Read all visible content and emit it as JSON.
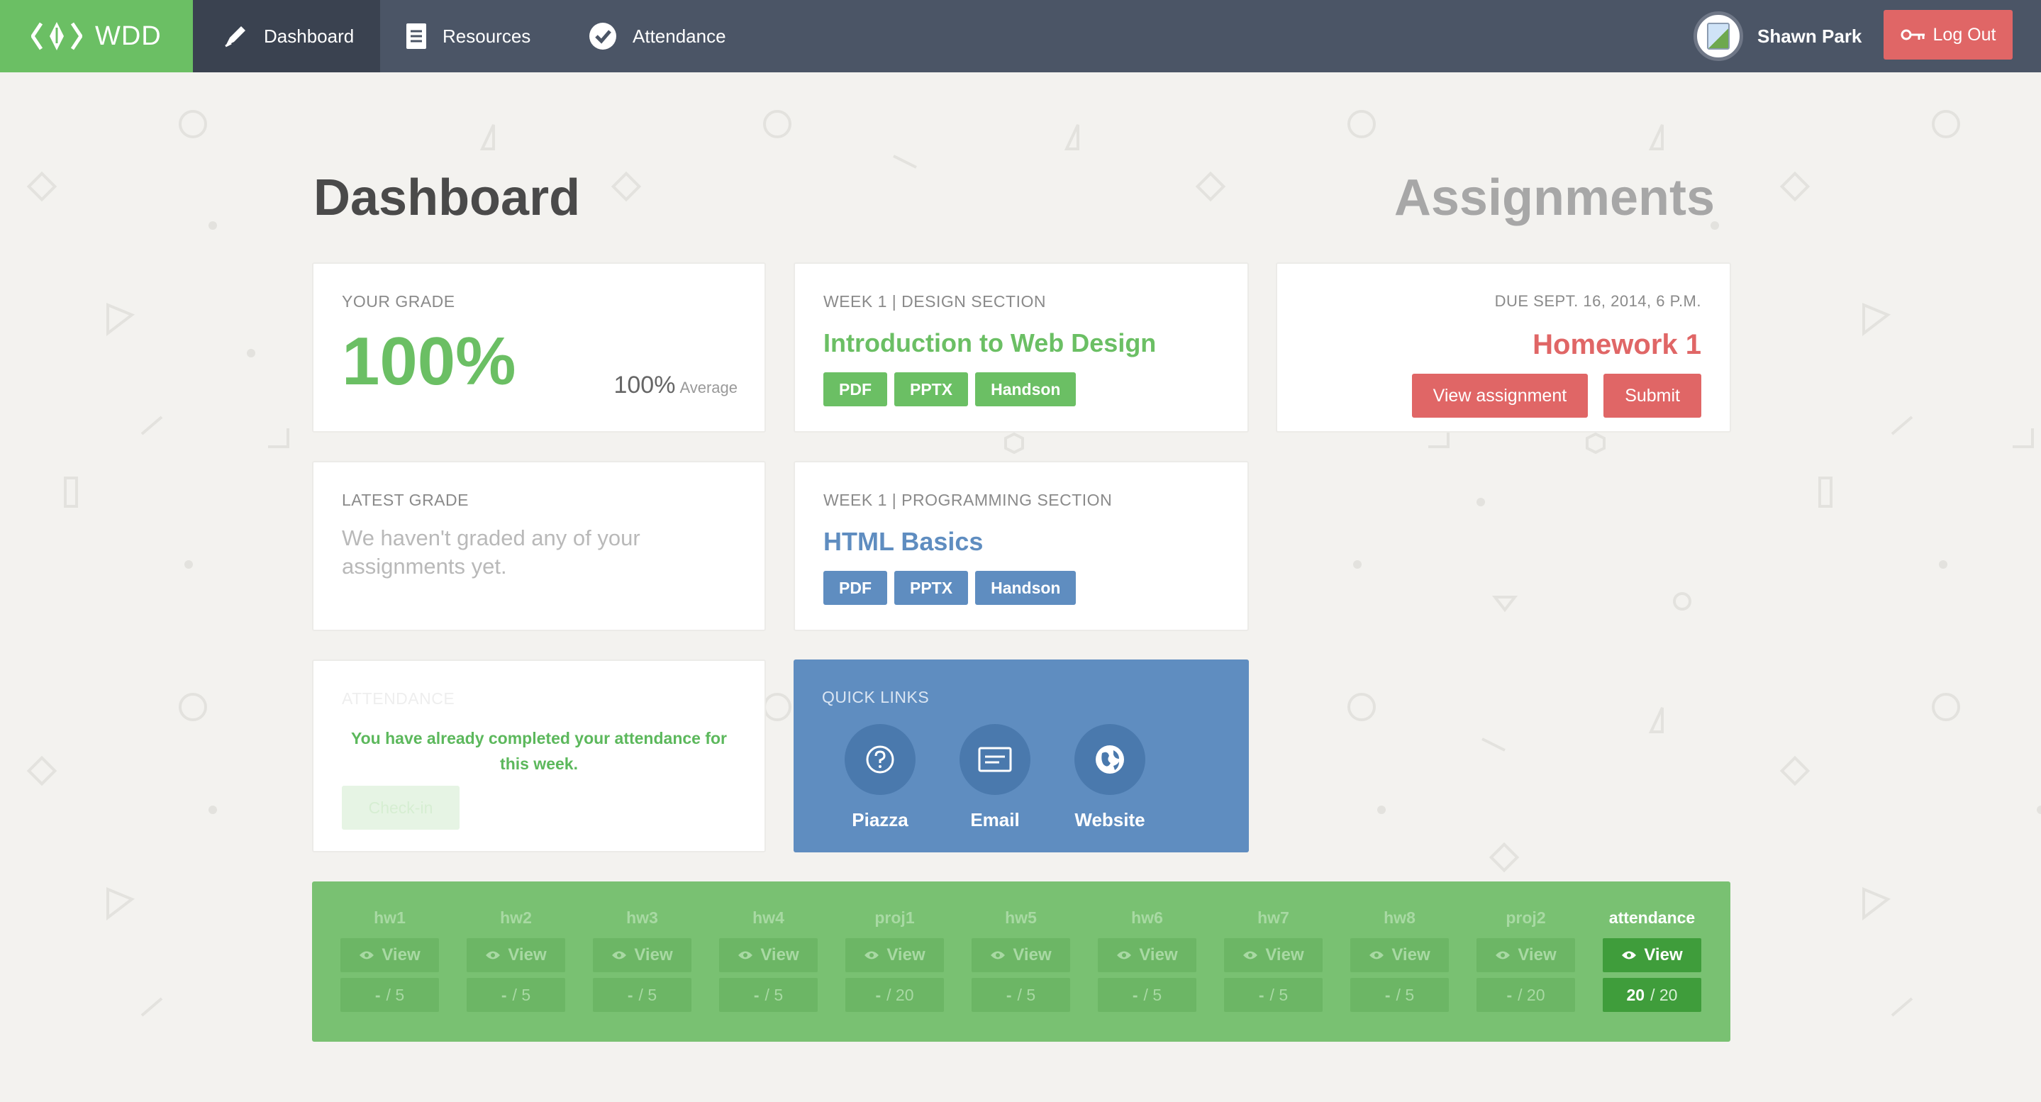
{
  "brand": {
    "name": "WDD"
  },
  "nav": {
    "items": [
      {
        "label": "Dashboard"
      },
      {
        "label": "Resources"
      },
      {
        "label": "Attendance"
      }
    ]
  },
  "user": {
    "name": "Shawn Park",
    "logout_label": "Log Out"
  },
  "headings": {
    "dashboard": "Dashboard",
    "assignments": "Assignments"
  },
  "your_grade": {
    "label": "YOUR GRADE",
    "value": "100%",
    "average_value": "100%",
    "average_label": "Average"
  },
  "latest_grade": {
    "label": "LATEST GRADE",
    "message": "We haven't graded any of your assignments yet."
  },
  "attendance": {
    "label": "ATTENDANCE",
    "message": "You have already completed your attendance for this week.",
    "checkin_label": "Check-in"
  },
  "week_design": {
    "label": "WEEK 1 | DESIGN SECTION",
    "title": "Introduction to Web Design",
    "tags": [
      "PDF",
      "PPTX",
      "Handson"
    ]
  },
  "week_programming": {
    "label": "WEEK 1 | PROGRAMMING SECTION",
    "title": "HTML Basics",
    "tags": [
      "PDF",
      "PPTX",
      "Handson"
    ]
  },
  "quick_links": {
    "label": "QUICK LINKS",
    "items": [
      {
        "label": "Piazza",
        "icon": "help-icon"
      },
      {
        "label": "Email",
        "icon": "email-icon"
      },
      {
        "label": "Website",
        "icon": "globe-icon"
      }
    ]
  },
  "homework": {
    "due": "DUE SEPT. 16, 2014, 6 P.M.",
    "title": "Homework 1",
    "view_label": "View assignment",
    "submit_label": "Submit"
  },
  "grades": [
    {
      "name": "hw1",
      "view": "View",
      "score": "-",
      "total": "5"
    },
    {
      "name": "hw2",
      "view": "View",
      "score": "-",
      "total": "5"
    },
    {
      "name": "hw3",
      "view": "View",
      "score": "-",
      "total": "5"
    },
    {
      "name": "hw4",
      "view": "View",
      "score": "-",
      "total": "5"
    },
    {
      "name": "proj1",
      "view": "View",
      "score": "-",
      "total": "20"
    },
    {
      "name": "hw5",
      "view": "View",
      "score": "-",
      "total": "5"
    },
    {
      "name": "hw6",
      "view": "View",
      "score": "-",
      "total": "5"
    },
    {
      "name": "hw7",
      "view": "View",
      "score": "-",
      "total": "5"
    },
    {
      "name": "hw8",
      "view": "View",
      "score": "-",
      "total": "5"
    },
    {
      "name": "proj2",
      "view": "View",
      "score": "-",
      "total": "20"
    },
    {
      "name": "attendance",
      "view": "View",
      "score": "20",
      "total": "20"
    }
  ],
  "colors": {
    "green": "#6bbf64",
    "blue": "#5f8dc0",
    "red": "#e06666",
    "nav": "#4b5566"
  }
}
